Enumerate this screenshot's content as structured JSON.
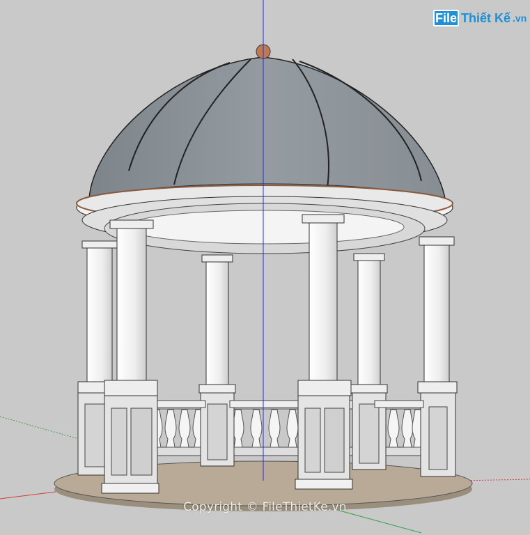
{
  "logo": {
    "badge": "File",
    "name": "Thiết Kế",
    "tld": ".vn"
  },
  "watermark": "Copyright © FileThietKe.vn",
  "colors": {
    "background": "#c9c9c9",
    "dome": "#8f969c",
    "rim": "#e8e8e8",
    "column": "#f4f4f4",
    "floor": "#b8aa96",
    "finial": "#c07a52",
    "axis_blue": "#2b2bd6",
    "axis_red": "#d43a3a",
    "axis_green": "#3aa04a"
  }
}
